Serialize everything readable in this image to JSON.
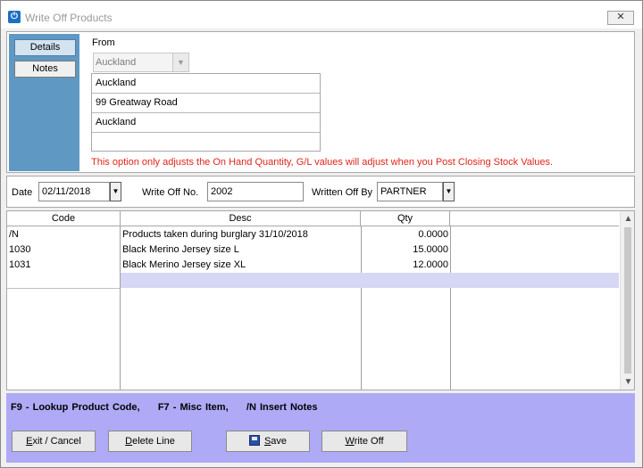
{
  "window": {
    "title": "Write Off Products",
    "close_icon": "close-icon"
  },
  "side_tabs": [
    {
      "label": "Details",
      "active": true
    },
    {
      "label": "Notes",
      "active": false
    }
  ],
  "from": {
    "label": "From",
    "combo_value": "Auckland",
    "address_lines": [
      "Auckland",
      "99 Greatway Road",
      "Auckland",
      ""
    ]
  },
  "warning": "This option only adjusts the On Hand Quantity, G/L values will adjust when you Post Closing Stock Values.",
  "date_row": {
    "date_label": "Date",
    "date_value": "02/11/2018",
    "write_off_no_label": "Write Off No.",
    "write_off_no_value": "2002",
    "written_off_by_label": "Written Off By",
    "written_off_by_value": "PARTNER"
  },
  "grid": {
    "headers": [
      "Code",
      "Desc",
      "Qty"
    ],
    "rows": [
      {
        "code": "/N",
        "desc": "Products taken during burglary 31/10/2018",
        "qty": "0.0000"
      },
      {
        "code": "1030",
        "desc": "Black Merino Jersey size L",
        "qty": "15.0000"
      },
      {
        "code": "1031",
        "desc": "Black Merino Jersey size XL",
        "qty": "12.0000"
      },
      {
        "code": "",
        "desc": "",
        "qty": ""
      }
    ]
  },
  "footer": {
    "hint": "F9 - Lookup Product Code,     F7 - Misc Item,     /N Insert Notes",
    "buttons": {
      "exit_u": "E",
      "exit_rest": "xit / Cancel",
      "delete_u": "D",
      "delete_rest": "elete Line",
      "save_u": "S",
      "save_rest": "ave",
      "writeoff_u": "W",
      "writeoff_rest": "rite Off"
    }
  },
  "colors": {
    "side_tabs_bg": "#5f99c3",
    "footer_bg": "#aeaaf6",
    "warning_text": "#e0241b",
    "new_row_bg": "#d6d6f5"
  }
}
